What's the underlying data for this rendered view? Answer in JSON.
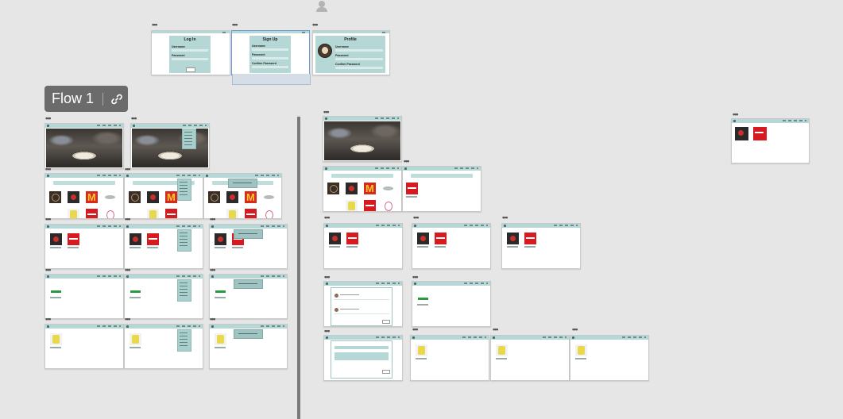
{
  "canvas": {
    "background": "#e6e6e6",
    "flow_label": "Flow 1",
    "link_icon": "link-icon",
    "user_icon": "user-icon"
  },
  "auth_screens": {
    "login_title": "Log In",
    "signup_title": "Sign Up",
    "profile_title": "Profile",
    "username_label": "Username",
    "password_label": "Password",
    "confirm_password_label": "Confirm Password"
  },
  "colors": {
    "accent": "#b5d8d6",
    "divider": "#7a7a7a",
    "selection": "#6a9bd8",
    "badge": "#6b6b6b"
  },
  "frame_ellipsis": "•••"
}
